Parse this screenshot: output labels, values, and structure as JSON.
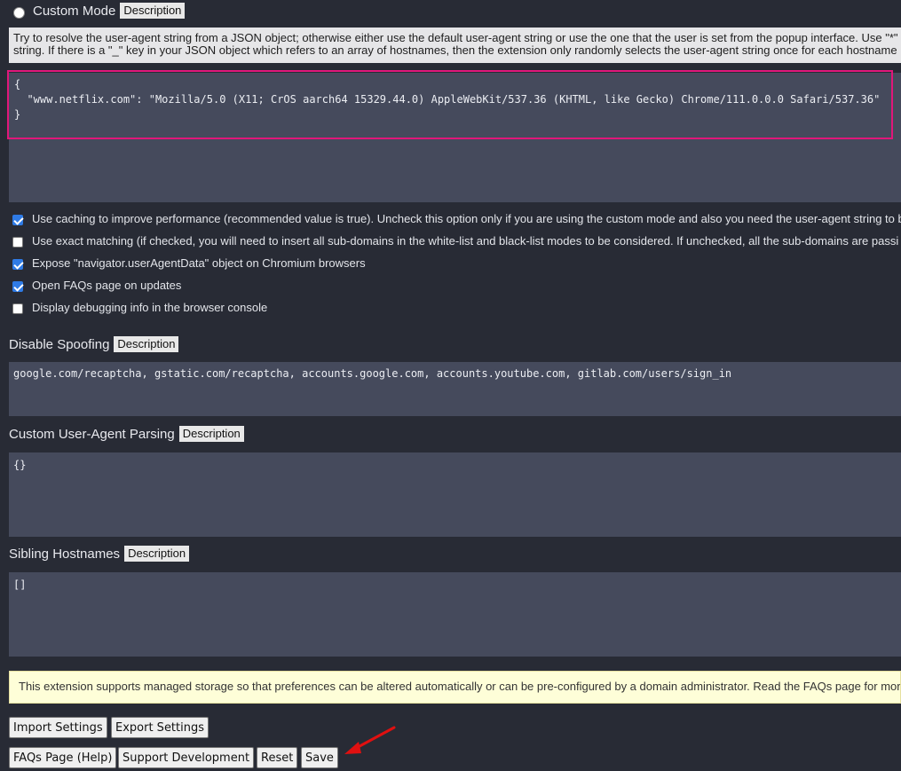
{
  "custom_mode": {
    "label": "Custom Mode",
    "badge": "Description",
    "description_line1": "Try to resolve the user-agent string from a JSON object; otherwise either use the default user-agent string or use the one that the user is set from the popup interface. Use \"*\"",
    "description_line2": "string. If there is a \"_\" key in your JSON object which refers to an array of hostnames, then the extension only randomly selects the user-agent string once for each hostname",
    "json_value": "{\n  \"www.netflix.com\": \"Mozilla/5.0 (X11; CrOS aarch64 15329.44.0) AppleWebKit/537.36 (KHTML, like Gecko) Chrome/111.0.0.0 Safari/537.36\"\n}"
  },
  "options": [
    {
      "label": "Use caching to improve performance (recommended value is true). Uncheck this option only if you are using the custom mode and also you need the user-agent string to b",
      "checked": true
    },
    {
      "label": "Use exact matching (if checked, you will need to insert all sub-domains in the white-list and black-list modes to be considered. If unchecked, all the sub-domains are passi",
      "checked": false
    },
    {
      "label": "Expose \"navigator.userAgentData\" object on Chromium browsers",
      "checked": true
    },
    {
      "label": "Open FAQs page on updates",
      "checked": true
    },
    {
      "label": "Display debugging info in the browser console",
      "checked": false
    }
  ],
  "disable_spoofing": {
    "title": "Disable Spoofing",
    "badge": "Description",
    "value": "google.com/recaptcha, gstatic.com/recaptcha, accounts.google.com, accounts.youtube.com, gitlab.com/users/sign_in"
  },
  "custom_parsing": {
    "title": "Custom User-Agent Parsing",
    "badge": "Description",
    "value": "{}"
  },
  "sibling_hostnames": {
    "title": "Sibling Hostnames",
    "badge": "Description",
    "value": "[]"
  },
  "managed_note": "This extension supports managed storage so that preferences can be altered automatically or can be pre-configured by a domain administrator. Read the FAQs page for mor",
  "buttons": {
    "import": "Import Settings",
    "export": "Export Settings",
    "faqs": "FAQs Page (Help)",
    "support": "Support Development",
    "reset": "Reset",
    "save": "Save"
  },
  "colors": {
    "background": "#282b35",
    "textarea": "#454a5c",
    "focus_outline": "#e0177a",
    "checkbox": "#2f7be6",
    "annotation_arrow": "#e01010"
  }
}
